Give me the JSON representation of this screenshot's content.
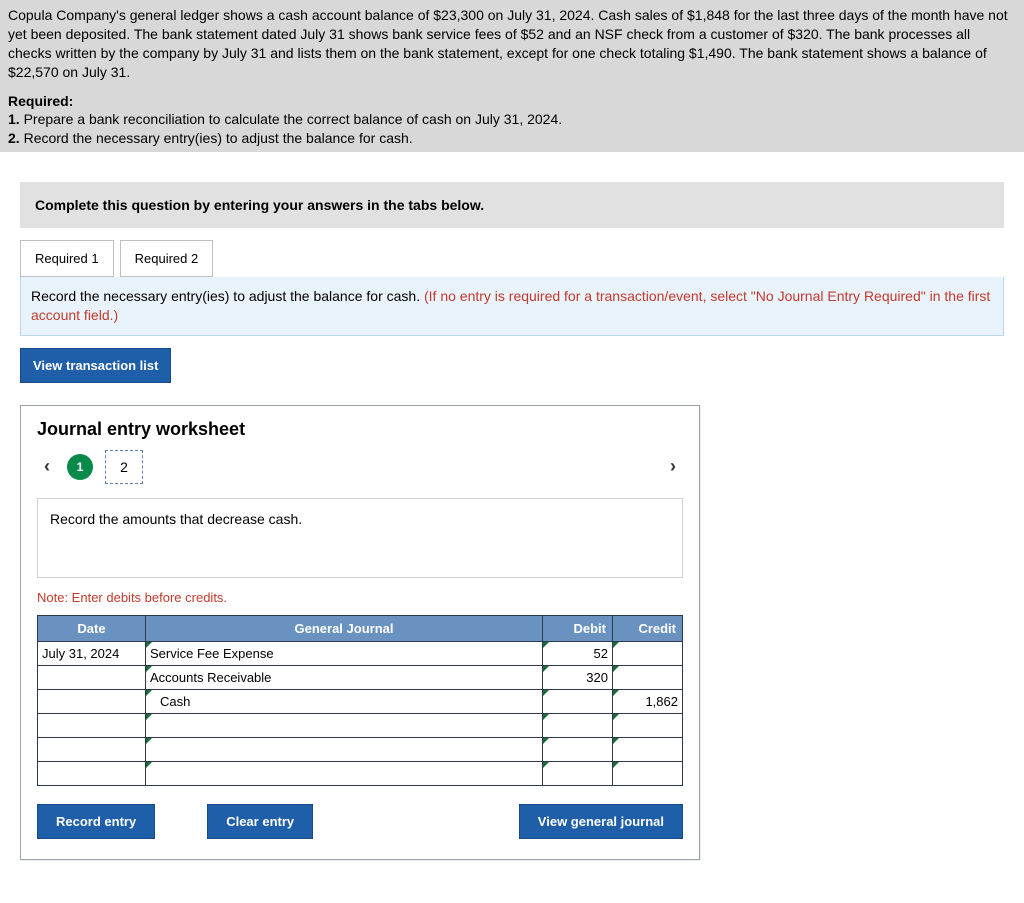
{
  "problem": {
    "paragraph": "Copula Company's general ledger shows a cash account balance of $23,300 on July 31, 2024. Cash sales of $1,848 for the last three days of the month have not yet been deposited. The bank statement dated July 31 shows bank service fees of $52 and an NSF check from a customer of $320. The bank processes all checks written by the company by July 31 and lists them on the bank statement, except for one check totaling $1,490. The bank statement shows a balance of $22,570 on July 31.",
    "required_heading": "Required:",
    "req1_num": "1.",
    "req1_text": " Prepare a bank reconciliation to calculate the correct balance of cash on July 31, 2024.",
    "req2_num": "2.",
    "req2_text": " Record the necessary entry(ies) to adjust the balance for cash."
  },
  "complete_box": "Complete this question by entering your answers in the tabs below.",
  "tabs": {
    "t1": "Required 1",
    "t2": "Required 2"
  },
  "banner": {
    "black": "Record the necessary entry(ies) to adjust the balance for cash. ",
    "red": "(If no entry is required for a transaction/event, select \"No Journal Entry Required\" in the first account field.)"
  },
  "view_txn_btn": "View transaction list",
  "worksheet": {
    "title": "Journal entry worksheet",
    "step_active": "1",
    "step_next": "2",
    "instruction": "Record the amounts that decrease cash.",
    "note": "Note: Enter debits before credits.",
    "headers": {
      "date": "Date",
      "gj": "General Journal",
      "debit": "Debit",
      "credit": "Credit"
    },
    "rows": [
      {
        "date": "July 31, 2024",
        "gj": "Service Fee Expense",
        "debit": "52",
        "credit": "",
        "indent": 1
      },
      {
        "date": "",
        "gj": "Accounts Receivable",
        "debit": "320",
        "credit": "",
        "indent": 1
      },
      {
        "date": "",
        "gj": "Cash",
        "debit": "",
        "credit": "1,862",
        "indent": 2
      },
      {
        "date": "",
        "gj": "",
        "debit": "",
        "credit": "",
        "indent": 1
      },
      {
        "date": "",
        "gj": "",
        "debit": "",
        "credit": "",
        "indent": 1
      },
      {
        "date": "",
        "gj": "",
        "debit": "",
        "credit": "",
        "indent": 1
      }
    ],
    "buttons": {
      "record": "Record entry",
      "clear": "Clear entry",
      "view_gj": "View general journal"
    }
  }
}
